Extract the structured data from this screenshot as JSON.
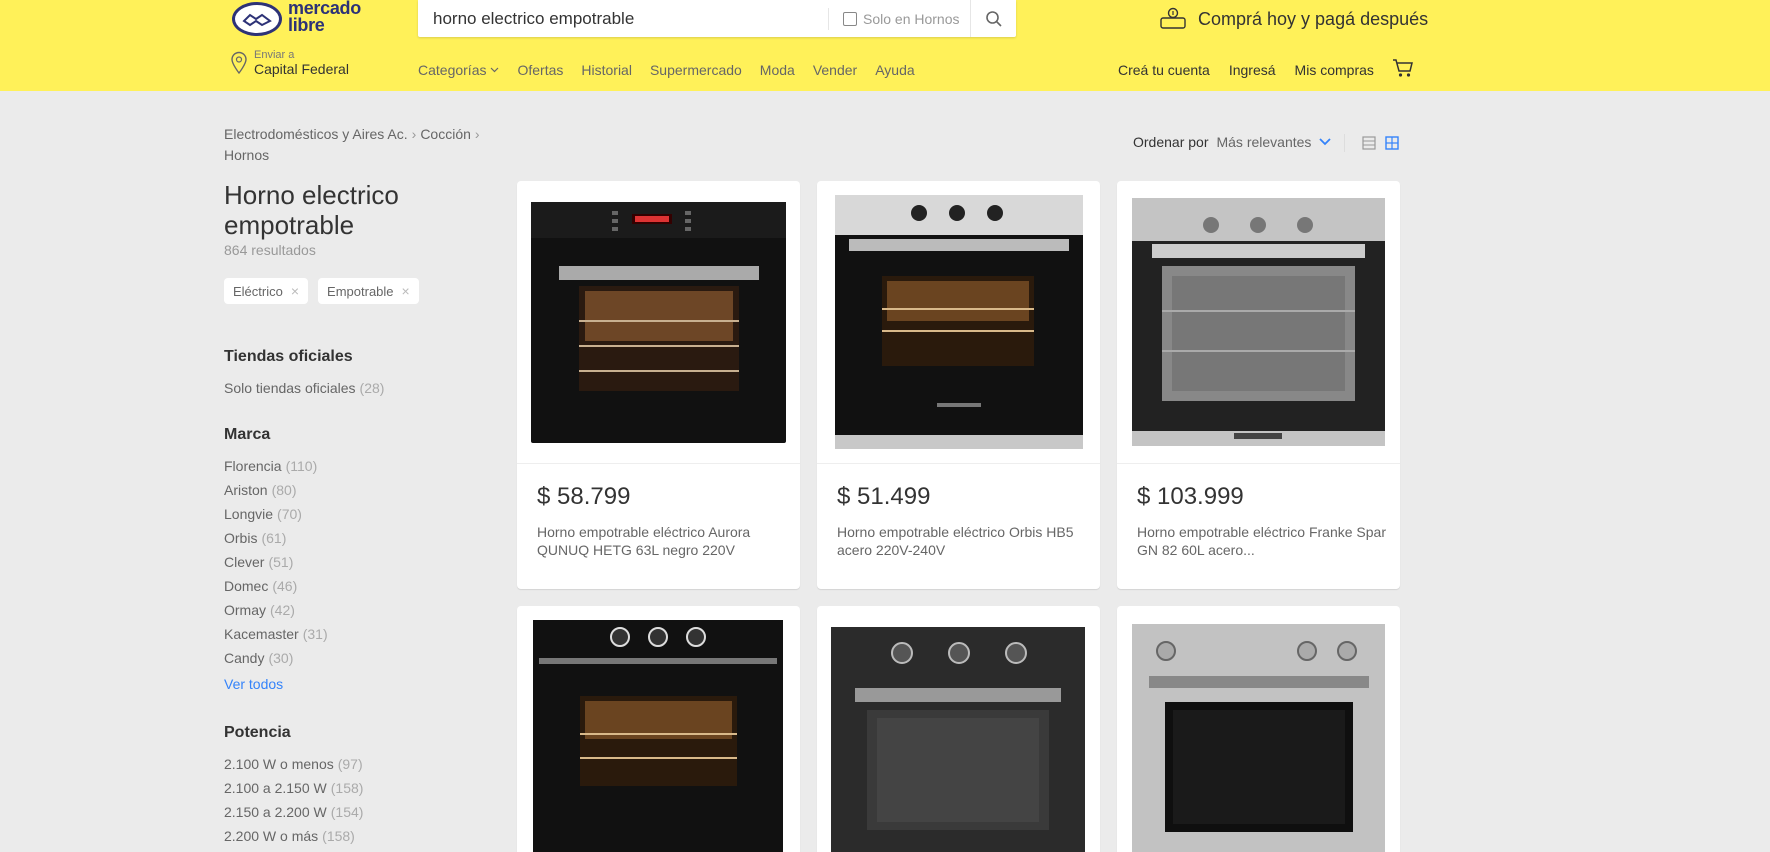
{
  "header": {
    "logo_text_line1": "mercado",
    "logo_text_line2": "libre",
    "search": {
      "value": "horno electrico empotrable",
      "filter_label": "Solo en Hornos"
    },
    "promo_text": "Comprá hoy y pagá después",
    "location": {
      "label": "Enviar a",
      "value": "Capital Federal"
    },
    "nav": [
      "Categorías",
      "Ofertas",
      "Historial",
      "Supermercado",
      "Moda",
      "Vender",
      "Ayuda"
    ],
    "user_nav": [
      "Creá tu cuenta",
      "Ingresá",
      "Mis compras"
    ]
  },
  "breadcrumb": [
    "Electrodomésticos y Aires Ac.",
    "Cocción",
    "Hornos"
  ],
  "page_title": "Horno electrico empotrable",
  "results_count": "864 resultados",
  "applied_filters": [
    "Eléctrico",
    "Empotrable"
  ],
  "facets": {
    "official_stores": {
      "title": "Tiendas oficiales",
      "items": [
        {
          "label": "Solo tiendas oficiales",
          "count": "(28)"
        }
      ]
    },
    "brand": {
      "title": "Marca",
      "items": [
        {
          "label": "Florencia",
          "count": "(110)"
        },
        {
          "label": "Ariston",
          "count": "(80)"
        },
        {
          "label": "Longvie",
          "count": "(70)"
        },
        {
          "label": "Orbis",
          "count": "(61)"
        },
        {
          "label": "Clever",
          "count": "(51)"
        },
        {
          "label": "Domec",
          "count": "(46)"
        },
        {
          "label": "Ormay",
          "count": "(42)"
        },
        {
          "label": "Kacemaster",
          "count": "(31)"
        },
        {
          "label": "Candy",
          "count": "(30)"
        }
      ],
      "see_all": "Ver todos"
    },
    "power": {
      "title": "Potencia",
      "items": [
        {
          "label": "2.100 W o menos",
          "count": "(97)"
        },
        {
          "label": "2.100 a 2.150 W",
          "count": "(158)"
        },
        {
          "label": "2.150 a 2.200 W",
          "count": "(154)"
        },
        {
          "label": "2.200 W o más",
          "count": "(158)"
        }
      ]
    }
  },
  "sort": {
    "label": "Ordenar por",
    "value": "Más relevantes"
  },
  "products": [
    {
      "price": "$ 58.799",
      "title": "Horno empotrable eléctrico Aurora QUNUQ HETG 63L negro 220V"
    },
    {
      "price": "$ 51.499",
      "title": "Horno empotrable eléctrico Orbis HB5 acero 220V-240V"
    },
    {
      "price": "$ 103.999",
      "title": "Horno empotrable eléctrico Franke Spar GN 82 60L acero..."
    },
    {
      "price": "",
      "title": ""
    },
    {
      "price": "",
      "title": ""
    },
    {
      "price": "",
      "title": ""
    }
  ],
  "colors": {
    "header_bg": "#fff159",
    "page_bg": "#ebebeb",
    "link_blue": "#3483fa",
    "logo_blue": "#2d3277"
  }
}
